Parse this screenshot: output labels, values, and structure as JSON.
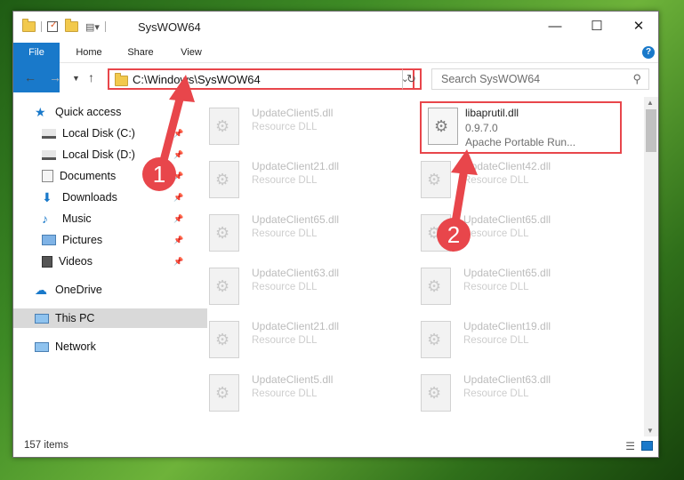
{
  "window": {
    "title": "SysWOW64"
  },
  "ribbon": {
    "tabs": [
      "File",
      "Home",
      "Share",
      "View"
    ]
  },
  "address": {
    "path": "C:\\Windows\\SysWOW64"
  },
  "search": {
    "placeholder": "Search SysWOW64"
  },
  "sidebar": {
    "items": [
      {
        "label": "Quick access"
      },
      {
        "label": "Local Disk (C:)"
      },
      {
        "label": "Local Disk (D:)"
      },
      {
        "label": "Documents"
      },
      {
        "label": "Downloads"
      },
      {
        "label": "Music"
      },
      {
        "label": "Pictures"
      },
      {
        "label": "Videos"
      },
      {
        "label": "OneDrive"
      },
      {
        "label": "This PC"
      },
      {
        "label": "Network"
      }
    ]
  },
  "files": {
    "highlighted": {
      "name": "libaprutil.dll",
      "version": "0.9.7.0",
      "description": "Apache Portable Run..."
    },
    "left": [
      {
        "name": "UpdateClient5.dll",
        "type": "Resource DLL"
      },
      {
        "name": "UpdateClient21.dll",
        "type": "Resource DLL"
      },
      {
        "name": "UpdateClient65.dll",
        "type": "Resource DLL"
      },
      {
        "name": "UpdateClient63.dll",
        "type": "Resource DLL"
      },
      {
        "name": "UpdateClient21.dll",
        "type": "Resource DLL"
      },
      {
        "name": "UpdateClient5.dll",
        "type": "Resource DLL"
      }
    ],
    "right": [
      {
        "name": "UpdateClient42.dll",
        "type": "Resource DLL"
      },
      {
        "name": "UpdateClient65.dll",
        "type": "Resource DLL"
      },
      {
        "name": "UpdateClient65.dll",
        "type": "Resource DLL"
      },
      {
        "name": "UpdateClient19.dll",
        "type": "Resource DLL"
      },
      {
        "name": "UpdateClient63.dll",
        "type": "Resource DLL"
      }
    ]
  },
  "status": {
    "count": "157 items"
  },
  "annotations": {
    "step1": "1",
    "step2": "2",
    "color": "#e8464b"
  }
}
